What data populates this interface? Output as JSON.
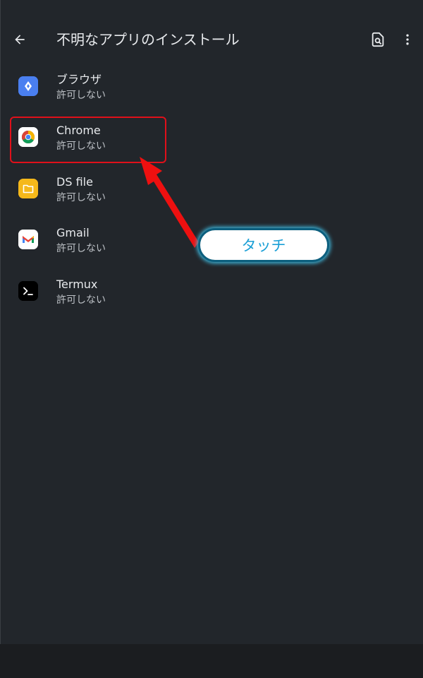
{
  "header": {
    "title": "不明なアプリのインストール",
    "back_icon": "arrow-back-icon",
    "search_icon": "search-in-page-icon",
    "more_icon": "more-vert-icon"
  },
  "apps": [
    {
      "name": "ブラウザ",
      "status": "許可しない",
      "icon": "browser-icon",
      "icon_bg": "#4a7ff0"
    },
    {
      "name": "Chrome",
      "status": "許可しない",
      "icon": "chrome-icon",
      "icon_bg": "#ffffff"
    },
    {
      "name": "DS file",
      "status": "許可しない",
      "icon": "folder-icon",
      "icon_bg": "#f5b81a"
    },
    {
      "name": "Gmail",
      "status": "許可しない",
      "icon": "gmail-icon",
      "icon_bg": "#ffffff"
    },
    {
      "name": "Termux",
      "status": "許可しない",
      "icon": "terminal-icon",
      "icon_bg": "#000000"
    }
  ],
  "annotation": {
    "callout_text": "タッチ",
    "highlight_color": "#e0101a",
    "callout_text_color": "#1a9fd6"
  }
}
